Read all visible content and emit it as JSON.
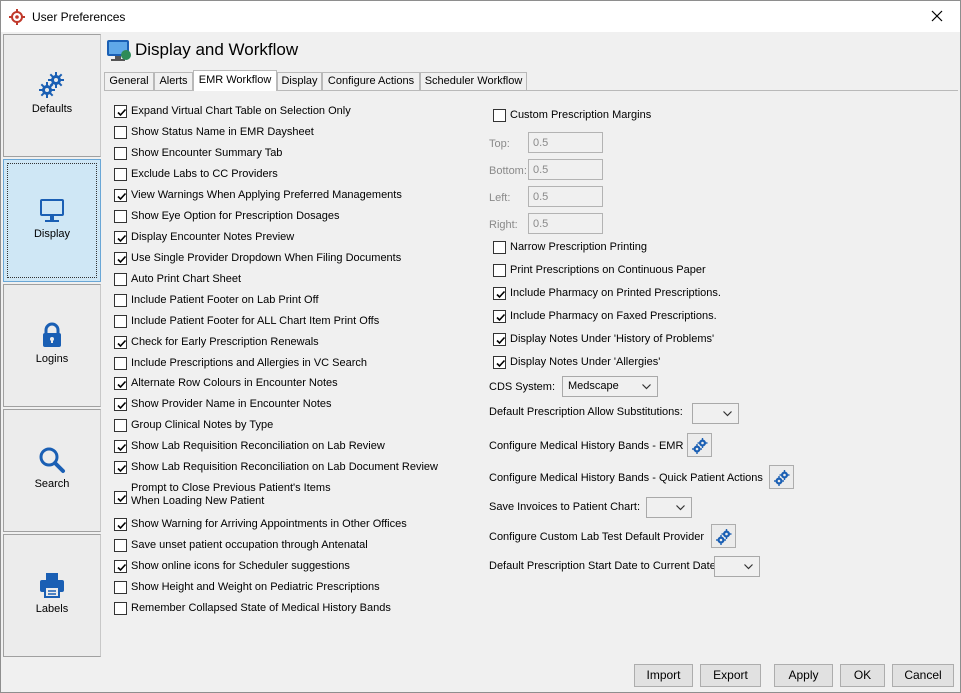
{
  "window": {
    "title": "User Preferences"
  },
  "sidebar": {
    "items": [
      {
        "label": "Defaults",
        "icon": "gears-icon"
      },
      {
        "label": "Display",
        "icon": "monitor-icon"
      },
      {
        "label": "Logins",
        "icon": "lock-icon"
      },
      {
        "label": "Search",
        "icon": "magnifier-icon"
      },
      {
        "label": "Labels",
        "icon": "printer-icon"
      }
    ],
    "active_index": 1
  },
  "panel": {
    "title": "Display and Workflow"
  },
  "tabs": [
    "General",
    "Alerts",
    "EMR Workflow",
    "Display",
    "Configure Actions",
    "Scheduler Workflow"
  ],
  "active_tab": 2,
  "left_options": [
    {
      "label": "Expand Virtual Chart Table on Selection Only",
      "checked": true
    },
    {
      "label": "Show Status Name in EMR Daysheet",
      "checked": false
    },
    {
      "label": "Show Encounter Summary Tab",
      "checked": false
    },
    {
      "label": "Exclude Labs to CC Providers",
      "checked": false
    },
    {
      "label": "View Warnings When Applying Preferred Managements",
      "checked": true
    },
    {
      "label": "Show Eye Option for Prescription Dosages",
      "checked": false
    },
    {
      "label": "Display Encounter Notes Preview",
      "checked": true
    },
    {
      "label": "Use Single Provider Dropdown When Filing Documents",
      "checked": true
    },
    {
      "label": "Auto Print Chart Sheet",
      "checked": false
    },
    {
      "label": "Include Patient Footer on Lab Print Off",
      "checked": false
    },
    {
      "label": "Include Patient Footer for ALL Chart Item Print Offs",
      "checked": false
    },
    {
      "label": "Check for Early Prescription Renewals",
      "checked": true
    },
    {
      "label": "Include Prescriptions and Allergies in VC Search",
      "checked": false
    },
    {
      "label": "Alternate Row Colours in Encounter Notes",
      "checked": true
    },
    {
      "label": "Show Provider Name in Encounter Notes",
      "checked": true
    },
    {
      "label": "Group Clinical Notes by Type",
      "checked": false
    },
    {
      "label": "Show Lab Requisition Reconciliation on Lab Review",
      "checked": true
    },
    {
      "label": "Show Lab Requisition Reconciliation on Lab Document Review",
      "checked": true
    },
    {
      "label_line1": "Prompt to Close Previous Patient's Items",
      "label_line2": "When Loading New Patient",
      "checked": true
    },
    {
      "label": "Show Warning for Arriving Appointments in Other Offices",
      "checked": true
    },
    {
      "label": "Save unset patient occupation through Antenatal",
      "checked": false
    },
    {
      "label": "Show online icons for Scheduler suggestions",
      "checked": true
    },
    {
      "label": "Show Height and Weight on Pediatric Prescriptions",
      "checked": false
    },
    {
      "label": "Remember Collapsed State of Medical History Bands",
      "checked": false
    }
  ],
  "right": {
    "custom_margins": {
      "label": "Custom Prescription Margins",
      "checked": false
    },
    "margins": [
      {
        "label": "Top:",
        "value": "0.5"
      },
      {
        "label": "Bottom:",
        "value": "0.5"
      },
      {
        "label": "Left:",
        "value": "0.5"
      },
      {
        "label": "Right:",
        "value": "0.5"
      }
    ],
    "options": [
      {
        "label": "Narrow Prescription Printing",
        "checked": false
      },
      {
        "label": "Print Prescriptions on Continuous Paper",
        "checked": false
      },
      {
        "label": "Include Pharmacy on Printed Prescriptions.",
        "checked": true
      },
      {
        "label": "Include Pharmacy on Faxed Prescriptions.",
        "checked": true
      },
      {
        "label": "Display Notes Under 'History of Problems'",
        "checked": true
      },
      {
        "label": "Display Notes Under 'Allergies'",
        "checked": true
      }
    ],
    "cds_system": {
      "label": "CDS System:",
      "value": "Medscape"
    },
    "allow_substitutions": {
      "label": "Default Prescription Allow Substitutions:",
      "value": ""
    },
    "config_history_emr": {
      "label": "Configure Medical History Bands - EMR"
    },
    "config_history_quick": {
      "label": "Configure Medical History Bands - Quick Patient Actions"
    },
    "save_invoices": {
      "label": "Save Invoices to Patient Chart:",
      "value": ""
    },
    "config_lab_provider": {
      "label": "Configure Custom Lab Test Default Provider"
    },
    "start_date": {
      "label": "Default Prescription Start Date to Current Date",
      "value": ""
    }
  },
  "footer": {
    "import_label": "Import",
    "export_label": "Export",
    "apply_label": "Apply",
    "ok_label": "OK",
    "cancel_label": "Cancel"
  },
  "colors": {
    "accent": "#1a5fb4",
    "selected_bg": "#cfe7f5",
    "app_icon": "#c0392b"
  }
}
